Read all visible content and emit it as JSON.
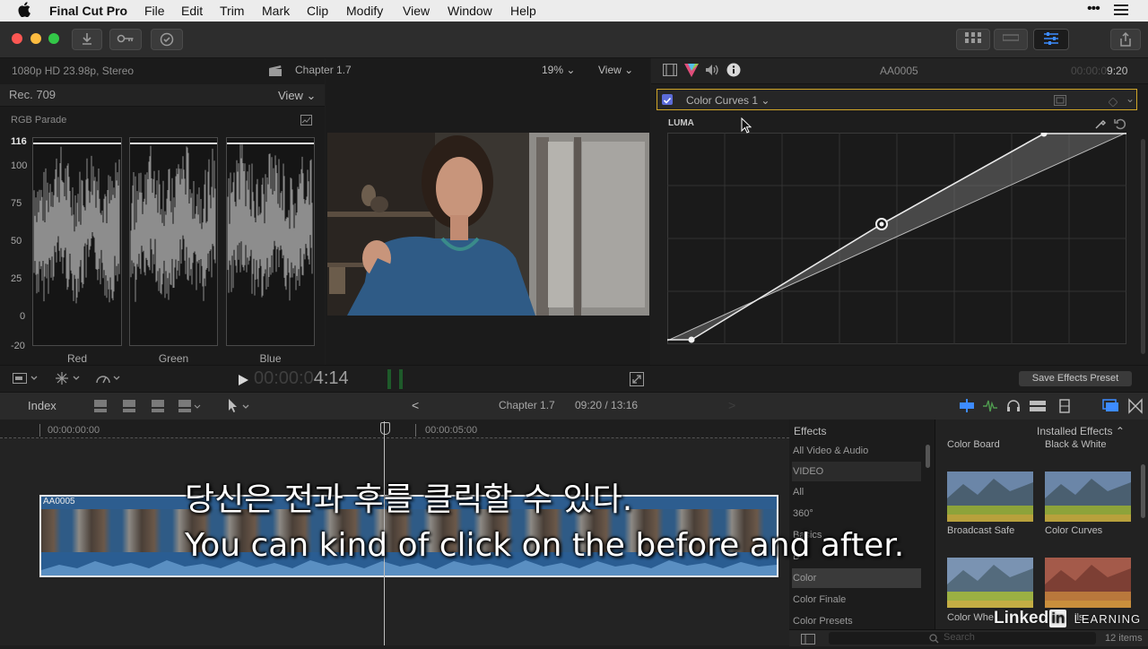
{
  "menubar": {
    "apple": "",
    "app_name": "Final Cut Pro",
    "items": [
      "File",
      "Edit",
      "Trim",
      "Mark",
      "Clip",
      "Modify",
      "View",
      "Window",
      "Help"
    ]
  },
  "scopes": {
    "format": "1080p HD 23.98p, Stereo",
    "colorspace": "Rec. 709",
    "view_menu": "View ⌄",
    "scope_name": "RGB Parade",
    "scale": [
      "116",
      "100",
      "75",
      "50",
      "25",
      "0",
      "-20"
    ],
    "lanes": [
      "Red",
      "Green",
      "Blue"
    ]
  },
  "viewer": {
    "project_title": "Chapter 1.7",
    "zoom": "19%",
    "view_menu": "View",
    "timecode_dim": "00:00:0",
    "timecode_bright": "4:14"
  },
  "inspector": {
    "clip_name": "AA0005",
    "duration_dim": "00:00:0",
    "duration_bright": "9:20",
    "effect_name": "Color Curves 1",
    "curve_label": "LUMA",
    "save_preset": "Save Effects Preset"
  },
  "timeline_bar": {
    "index": "Index",
    "project": "Chapter 1.7",
    "position": "09:20 / 13:16"
  },
  "timeline": {
    "ruler": [
      "00:00:00:00",
      "00:00:05:00"
    ],
    "clip_name": "AA0005"
  },
  "effects": {
    "header": "Effects",
    "installed": "Installed Effects",
    "categories": [
      "All Video & Audio",
      "VIDEO",
      "All",
      "360°",
      "Basics",
      "B",
      "Color",
      "Color Finale",
      "Color Presets"
    ],
    "items": [
      "Color Board",
      "Black & White",
      "Broadcast Safe",
      "Color Curves",
      "Color Whe",
      "lls"
    ],
    "search_placeholder": "Search",
    "count": "12 items"
  },
  "subtitles": {
    "korean": "당신은 전과 후를 클릭할 수 있다.",
    "english": "You can kind of click on the before and after."
  },
  "watermark": {
    "brand": "Linked",
    "in": "in",
    "learning": "LEARNING"
  }
}
